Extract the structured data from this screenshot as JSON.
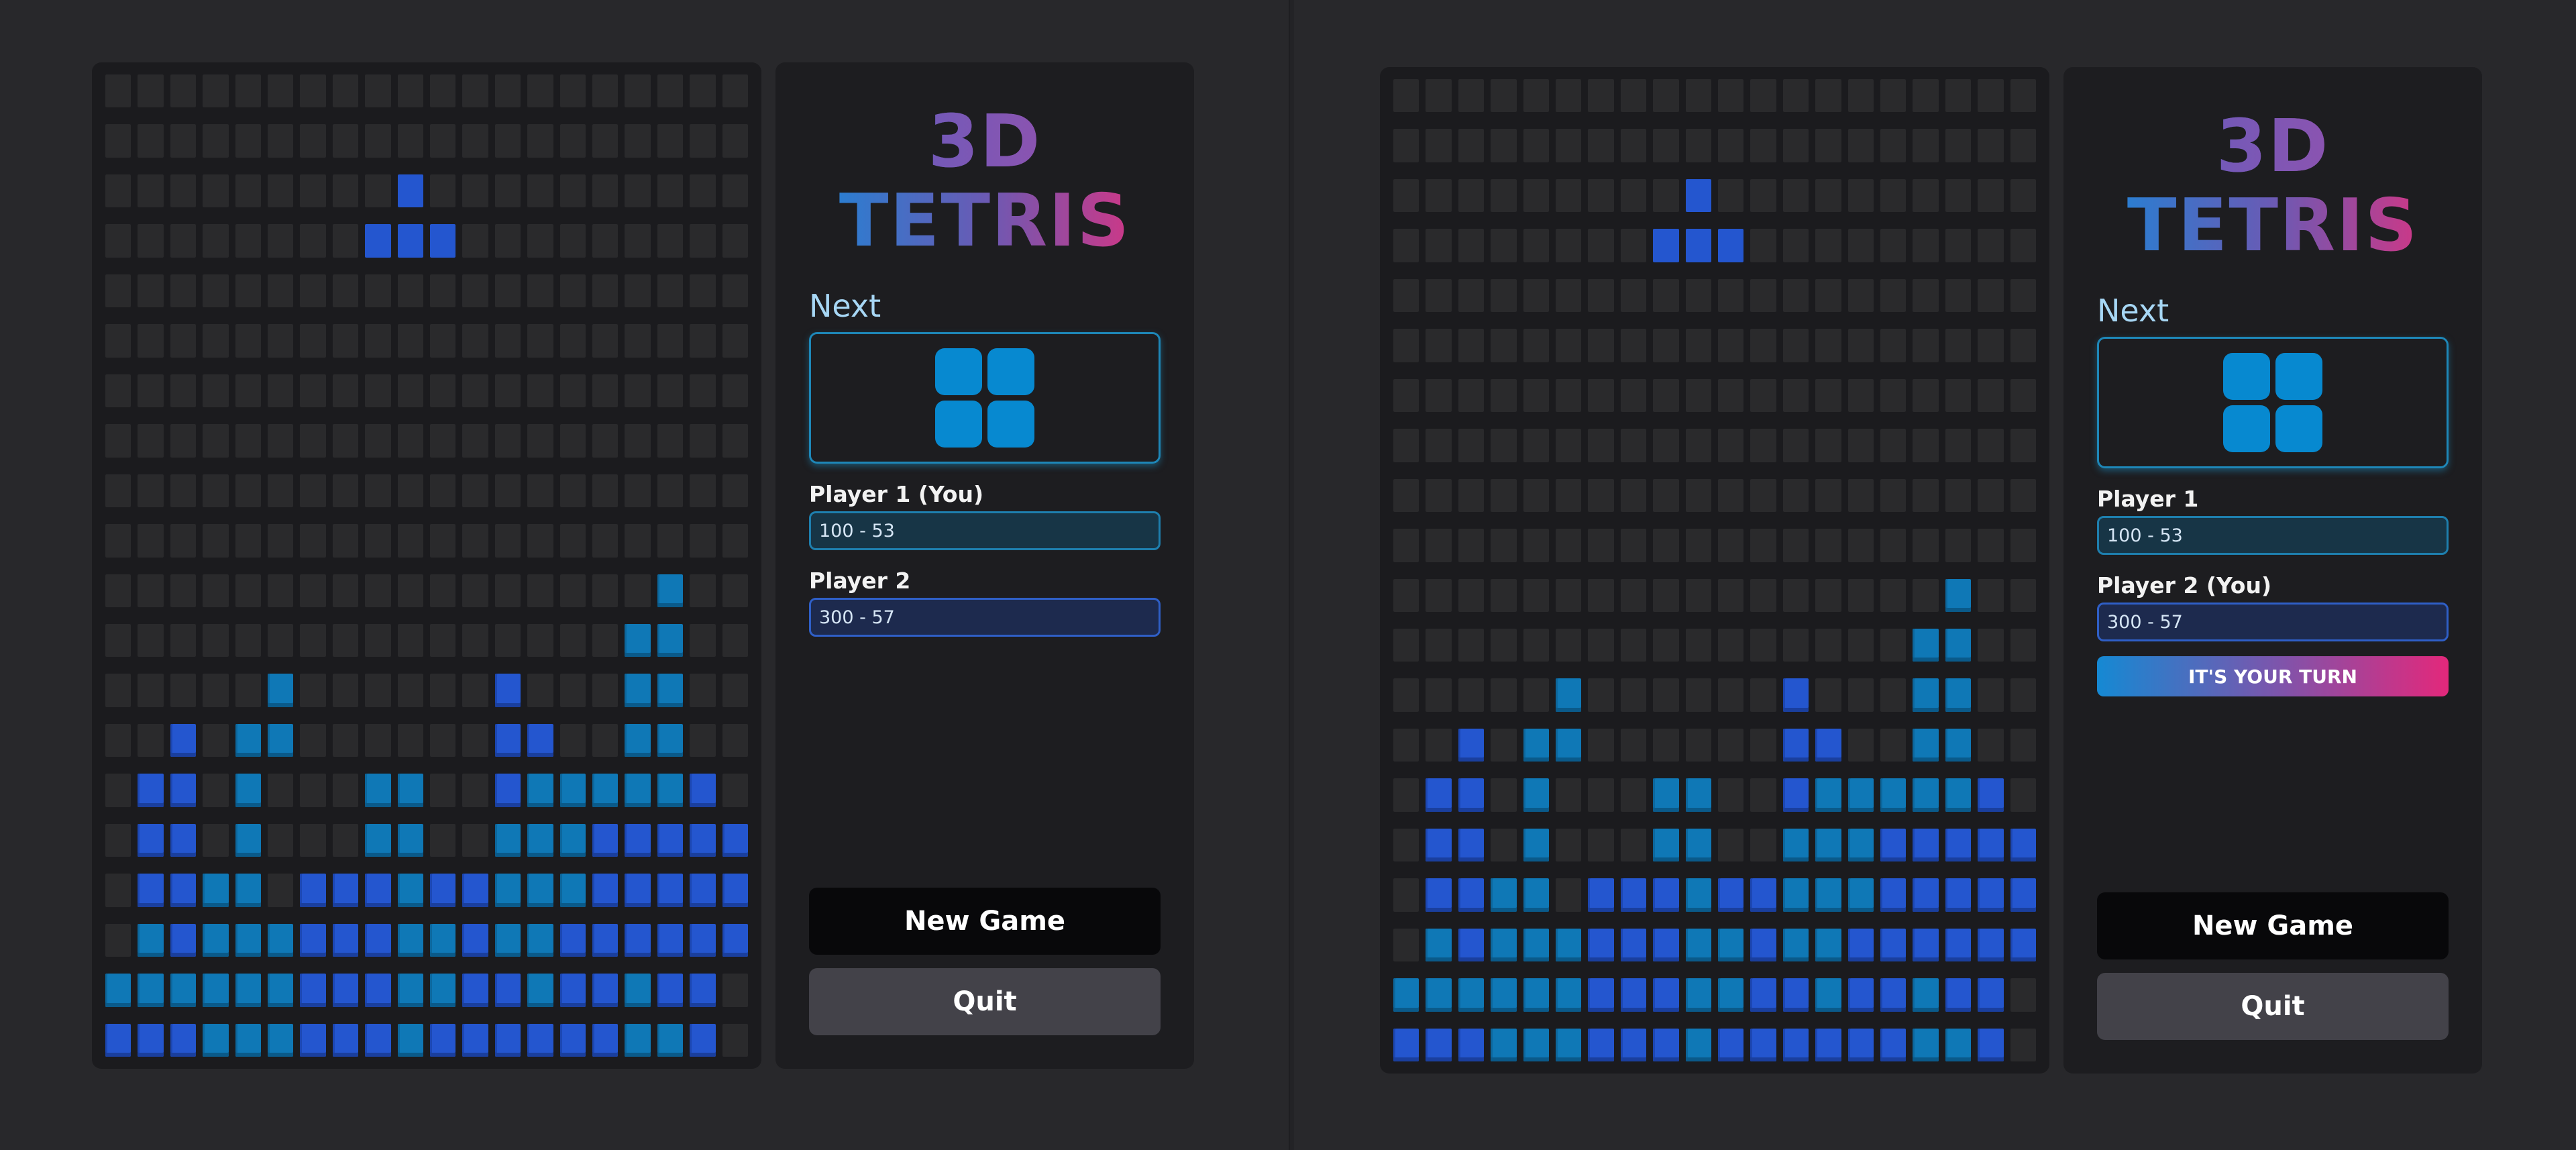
{
  "windows": [
    {
      "title_line1": "3D",
      "title_line2": "TETRIS",
      "next_label": "Next",
      "next_piece": "O",
      "players": [
        {
          "label": "Player 1 (You)",
          "score": "100 - 53"
        },
        {
          "label": "Player 2",
          "score": "300 - 57"
        }
      ],
      "turn_banner": null,
      "buttons": {
        "new_game": "New Game",
        "quit": "Quit"
      }
    },
    {
      "title_line1": "3D",
      "title_line2": "TETRIS",
      "next_label": "Next",
      "next_piece": "O",
      "players": [
        {
          "label": "Player 1",
          "score": "100 - 53"
        },
        {
          "label": "Player 2 (You)",
          "score": "300 - 57"
        }
      ],
      "turn_banner": "IT'S YOUR TURN",
      "buttons": {
        "new_game": "New Game",
        "quit": "Quit"
      }
    }
  ],
  "board": {
    "columns": 20,
    "rows": 20,
    "colors": {
      "b": "#2456cf",
      "t": "#0f78b6",
      "empty": "#2a2a2c"
    },
    "active_piece": {
      "shape": "T",
      "cells": [
        [
          2,
          9
        ],
        [
          3,
          8
        ],
        [
          3,
          9
        ],
        [
          3,
          10
        ]
      ]
    },
    "grid": [
      "....................",
      "....................",
      "....................",
      "....................",
      "....................",
      "....................",
      "....................",
      "....................",
      "....................",
      "....................",
      ".................t..",
      "................tt..",
      ".....t......b...tt..",
      "..b.tt......bb..tt..",
      ".bb.t...tt..btttttb.",
      ".bb.t...tt..tttbbbbb",
      ".bbtt.bbbtbbtttbbbbb",
      ".tbtttbbbttbttbbbbbb",
      "ttttttbbbttbbtbbtbb.",
      "bbbtttbbbtbbbbbbttb."
    ]
  }
}
